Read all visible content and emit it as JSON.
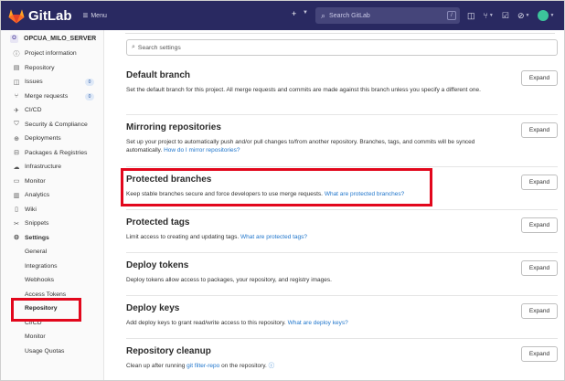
{
  "topbar": {
    "logo_text": "GitLab",
    "menu_label": "Menu",
    "plus_glyph": "+",
    "search_placeholder": "Search GitLab",
    "search_kbd": "/",
    "icons": [
      "issues-icon",
      "merge-requests-icon",
      "todos-icon",
      "help-icon",
      "avatar"
    ]
  },
  "sidebar": {
    "project_letter": "O",
    "project_name": "OPCUA_MILO_SERVER",
    "items": [
      {
        "label": "Project information",
        "icon": "info-icon"
      },
      {
        "label": "Repository",
        "icon": "repository-icon"
      },
      {
        "label": "Issues",
        "icon": "issues-icon",
        "badge": "0"
      },
      {
        "label": "Merge requests",
        "icon": "merge-requests-icon",
        "badge": "0"
      },
      {
        "label": "CI/CD",
        "icon": "rocket-icon"
      },
      {
        "label": "Security & Compliance",
        "icon": "shield-icon"
      },
      {
        "label": "Deployments",
        "icon": "deployments-icon"
      },
      {
        "label": "Packages & Registries",
        "icon": "package-icon"
      },
      {
        "label": "Infrastructure",
        "icon": "cloud-icon"
      },
      {
        "label": "Monitor",
        "icon": "monitor-icon"
      },
      {
        "label": "Analytics",
        "icon": "chart-icon"
      },
      {
        "label": "Wiki",
        "icon": "book-icon"
      },
      {
        "label": "Snippets",
        "icon": "scissors-icon"
      },
      {
        "label": "Settings",
        "icon": "gear-icon"
      }
    ],
    "settings_sub": [
      {
        "label": "General"
      },
      {
        "label": "Integrations"
      },
      {
        "label": "Webhooks"
      },
      {
        "label": "Access Tokens"
      },
      {
        "label": "Repository"
      },
      {
        "label": "CI/CD"
      },
      {
        "label": "Monitor"
      },
      {
        "label": "Usage Quotas"
      }
    ]
  },
  "main": {
    "search_placeholder": "Search settings",
    "expand_label": "Expand",
    "sections": [
      {
        "title": "Default branch",
        "desc": "Set the default branch for this project. All merge requests and commits are made against this branch unless you specify a different one.",
        "link": ""
      },
      {
        "title": "Mirroring repositories",
        "desc": "Set up your project to automatically push and/or pull changes to/from another repository. Branches, tags, and commits will be synced automatically.",
        "link": "How do I mirror repositories?"
      },
      {
        "title": "Protected branches",
        "desc": "Keep stable branches secure and force developers to use merge requests.",
        "link": "What are protected branches?"
      },
      {
        "title": "Protected tags",
        "desc": "Limit access to creating and updating tags.",
        "link": "What are protected tags?"
      },
      {
        "title": "Deploy tokens",
        "desc": "Deploy tokens allow access to packages, your repository, and registry images.",
        "link": ""
      },
      {
        "title": "Deploy keys",
        "desc": "Add deploy keys to grant read/write access to this repository.",
        "link": "What are deploy keys?"
      },
      {
        "title": "Repository cleanup",
        "desc": "Clean up after running",
        "link": "git filter-repo",
        "desc_after": "on the repository."
      }
    ]
  }
}
